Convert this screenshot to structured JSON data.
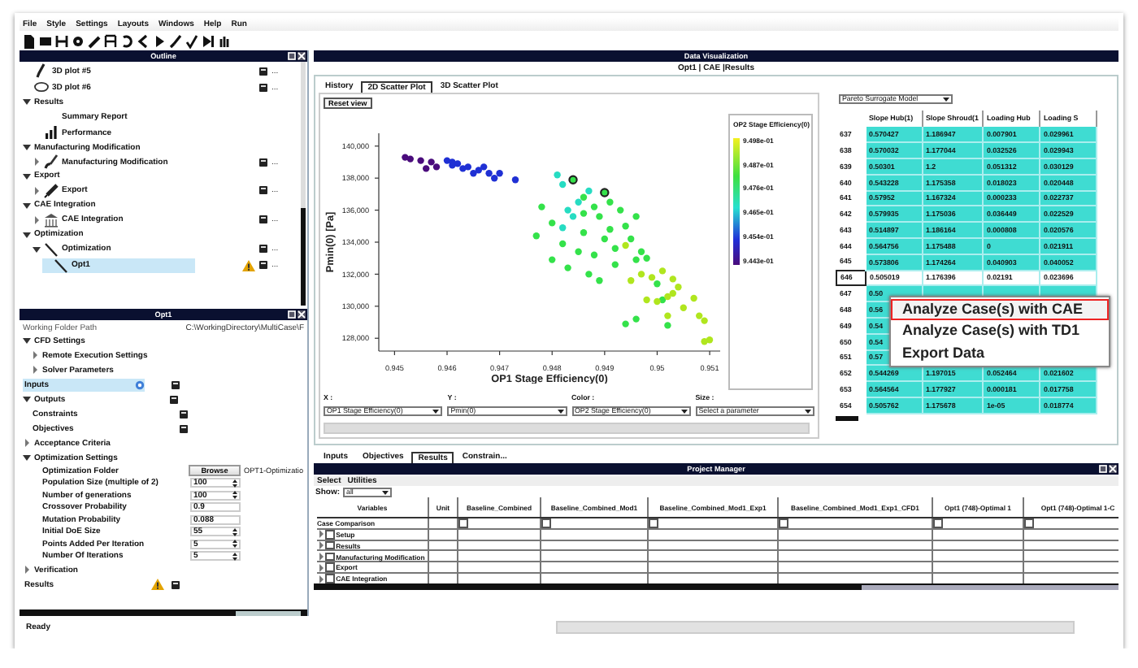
{
  "menu_bar": [
    "File",
    "Style",
    "Settings",
    "Layouts",
    "Windows",
    "Help",
    "Run"
  ],
  "outline": {
    "title": "Outline",
    "items": [
      {
        "kind": "entry",
        "label": "3D plot #5",
        "selected": false,
        "doc": true,
        "action": "..."
      },
      {
        "kind": "entry",
        "label": "3D plot #6",
        "selected": false,
        "doc": true,
        "action": "..."
      },
      {
        "kind": "section",
        "label": "Results",
        "expanded": true,
        "children": [
          {
            "kind": "entry",
            "label": "Summary Report",
            "selected": false
          },
          {
            "kind": "entry",
            "label": "Performance",
            "selected": false
          }
        ]
      },
      {
        "kind": "section",
        "label": "Manufacturing Modification",
        "expanded": true,
        "children": [
          {
            "kind": "entry",
            "label": "Manufacturing Modification",
            "expanded": false,
            "selected": false,
            "doc": true,
            "action": "..."
          }
        ]
      },
      {
        "kind": "section",
        "label": "Export",
        "expanded": true,
        "children": [
          {
            "kind": "entry",
            "label": "Export",
            "expanded": false,
            "selected": false,
            "doc": true,
            "action": "..."
          }
        ]
      },
      {
        "kind": "section",
        "label": "CAE Integration",
        "expanded": true,
        "children": [
          {
            "kind": "entry",
            "label": "CAE Integration",
            "expanded": false,
            "selected": false,
            "doc": true,
            "action": "..."
          }
        ]
      },
      {
        "kind": "section",
        "label": "Optimization",
        "expanded": true,
        "children": [
          {
            "kind": "entry",
            "label": "Optimization",
            "expanded": true,
            "selected": false,
            "doc": true,
            "action": "...",
            "children": [
              {
                "kind": "entry",
                "label": "Opt1",
                "selected": true,
                "warning": true,
                "doc": true,
                "action": "..."
              }
            ]
          }
        ]
      }
    ]
  },
  "properties": {
    "title": "Opt1",
    "path": {
      "label": "Working Folder Path",
      "value": "C:\\WorkingDirectory\\MultiCase\\F"
    },
    "items": [
      {
        "kind": "section",
        "label": "CFD Settings",
        "expanded": true,
        "children": [
          {
            "kind": "section",
            "label": "Remote Execution Settings",
            "expanded": false
          },
          {
            "kind": "section",
            "label": "Solver Parameters",
            "expanded": false
          }
        ]
      },
      {
        "kind": "entry",
        "label": "Inputs",
        "selected": true,
        "info": true,
        "doc": true
      },
      {
        "kind": "section",
        "label": "Outputs",
        "expanded": true,
        "doc": true,
        "children": [
          {
            "kind": "entry",
            "label": "Constraints",
            "selected": false,
            "doc": true
          },
          {
            "kind": "entry",
            "label": "Objectives",
            "selected": false,
            "doc": true
          }
        ]
      },
      {
        "kind": "section",
        "label": "Acceptance Criteria",
        "expanded": false
      },
      {
        "kind": "section",
        "label": "Optimization Settings",
        "expanded": true,
        "children": [
          {
            "kind": "browse",
            "label": "Optimization Folder",
            "button": "Browse",
            "value": "OPT1-Optimizatio"
          },
          {
            "kind": "spin",
            "label": "Population Size (multiple of 2)",
            "value": "100"
          },
          {
            "kind": "spin",
            "label": "Number of generations",
            "value": "100"
          },
          {
            "kind": "text",
            "label": "Crossover Probability",
            "value": "0.9"
          },
          {
            "kind": "text",
            "label": "Mutation Probability",
            "value": "0.088"
          },
          {
            "kind": "spin",
            "label": "Initial DoE Size",
            "value": "55"
          },
          {
            "kind": "spin",
            "label": "Points Added Per Iteration",
            "value": "5"
          },
          {
            "kind": "spin",
            "label": "Number Of Iterations",
            "value": "5"
          }
        ]
      },
      {
        "kind": "section",
        "label": "Verification",
        "expanded": false
      },
      {
        "kind": "entry",
        "label": "Results",
        "selected": false,
        "warning": true,
        "doc": true
      }
    ]
  },
  "visualization": {
    "title": "Data Visualization",
    "subtitle": "Opt1 | CAE |Results",
    "tabs": [
      {
        "label": "History",
        "selected": false
      },
      {
        "label": "2D Scatter Plot",
        "selected": true
      },
      {
        "label": "3D Scatter Plot",
        "selected": false
      }
    ],
    "reset_button": "Reset view",
    "chart_data": {
      "type": "scatter",
      "xlabel": "OP1 Stage Efficiency(0)",
      "ylabel": "Pmin(0) [Pa]",
      "xlim": [
        0.9447,
        0.9512
      ],
      "ylim": [
        127200,
        140800
      ],
      "xticks": [
        {
          "value": 0.945,
          "label": "0.945"
        },
        {
          "value": 0.946,
          "label": "0.946"
        },
        {
          "value": 0.947,
          "label": "0.947"
        },
        {
          "value": 0.948,
          "label": "0.948"
        },
        {
          "value": 0.949,
          "label": "0.949"
        },
        {
          "value": 0.95,
          "label": "0.95"
        },
        {
          "value": 0.951,
          "label": "0.951"
        }
      ],
      "yticks": [
        {
          "value": 128000,
          "label": "128,000"
        },
        {
          "value": 130000,
          "label": "130,000"
        },
        {
          "value": 132000,
          "label": "132,000"
        },
        {
          "value": 134000,
          "label": "134,000"
        },
        {
          "value": 136000,
          "label": "136,000"
        },
        {
          "value": 138000,
          "label": "138,000"
        },
        {
          "value": 140000,
          "label": "140,000"
        }
      ],
      "series": [
        {
          "color": "#4a0c7c",
          "x": [
            0.9452,
            0.9453,
            0.9455,
            0.9456,
            0.9457,
            0.9458
          ],
          "values": [
            139300,
            139200,
            139100,
            138600,
            139000,
            138700
          ]
        },
        {
          "color": "#1f30d4",
          "x": [
            0.946,
            0.9461,
            0.9462,
            0.9463,
            0.9464,
            0.9465,
            0.9466,
            0.9467,
            0.9468,
            0.947,
            0.9473,
            0.9461,
            0.9469
          ],
          "values": [
            139100,
            138800,
            138900,
            138600,
            138700,
            138300,
            138500,
            138700,
            138300,
            138300,
            137900,
            139000,
            138000
          ]
        },
        {
          "color": "#26dcc2",
          "x": [
            0.9481,
            0.9482,
            0.9483,
            0.9485,
            0.9487,
            0.9482,
            0.9484
          ],
          "values": [
            138200,
            137600,
            136000,
            136500,
            137200,
            134900,
            135600
          ]
        },
        {
          "color": "#34e24a",
          "x": [
            0.9478,
            0.9477,
            0.948,
            0.9482,
            0.9486,
            0.9488,
            0.9489,
            0.9491,
            0.9493,
            0.9494,
            0.9486,
            0.9488,
            0.949,
            0.9492,
            0.9495,
            0.9497,
            0.9483,
            0.9485,
            0.9487,
            0.9489,
            0.9492,
            0.9494,
            0.9496,
            0.9498,
            0.95,
            0.9501,
            0.9502,
            0.9496,
            0.9486,
            0.9491,
            0.948,
            0.9496
          ],
          "values": [
            136200,
            134400,
            135200,
            133900,
            136800,
            136200,
            135600,
            134800,
            136000,
            135000,
            134600,
            133200,
            134200,
            133600,
            134200,
            133400,
            132400,
            133400,
            132000,
            131600,
            132600,
            128900,
            132900,
            133000,
            131400,
            130400,
            128800,
            129200,
            135800,
            136500,
            132900,
            135600
          ]
        },
        {
          "color": "#b0e61e",
          "x": [
            0.9495,
            0.9497,
            0.9499,
            0.9501,
            0.9503,
            0.9504,
            0.9505,
            0.9507,
            0.9502,
            0.9508,
            0.9494,
            0.9498,
            0.95,
            0.9502,
            0.9509,
            0.951,
            0.9509,
            0.9503
          ],
          "values": [
            131600,
            132000,
            131800,
            132200,
            130800,
            131200,
            129900,
            130500,
            129400,
            129400,
            133800,
            130400,
            130300,
            130600,
            129100,
            127900,
            127800,
            131700
          ]
        },
        {
          "color": "#34e24a",
          "marker": "circle",
          "x": [
            0.9484,
            0.949
          ],
          "values": [
            137900,
            137100
          ]
        }
      ]
    },
    "color_scale": {
      "title": "OP2 Stage Efficiency(0)",
      "labels": [
        "9.498e-01",
        "9.487e-01",
        "9.476e-01",
        "9.465e-01",
        "9.454e-01",
        "9.443e-01"
      ]
    },
    "selectors": [
      {
        "label": "X :",
        "value": "OP1 Stage Efficiency(0)"
      },
      {
        "label": "Y :",
        "value": "Pmin(0)"
      },
      {
        "label": "Color :",
        "value": "OP2 Stage Efficiency(0)"
      },
      {
        "label": "Size :",
        "value": "Select a parameter"
      }
    ]
  },
  "surrogate": {
    "model": "Pareto Surrogate Model",
    "columns": [
      "Slope Hub(1)",
      "Slope Shroud(1",
      "Loading Hub",
      "Loading S"
    ],
    "rows": [
      {
        "id": "637",
        "selected": true,
        "cells": [
          "0.570427",
          "1.186947",
          "0.007901",
          "0.029961"
        ]
      },
      {
        "id": "638",
        "selected": true,
        "cells": [
          "0.570032",
          "1.177044",
          "0.032526",
          "0.029943"
        ]
      },
      {
        "id": "639",
        "selected": true,
        "cells": [
          "0.50301",
          "1.2",
          "0.051312",
          "0.030129"
        ]
      },
      {
        "id": "640",
        "selected": true,
        "cells": [
          "0.543228",
          "1.175358",
          "0.018023",
          "0.020448"
        ]
      },
      {
        "id": "641",
        "selected": true,
        "cells": [
          "0.57952",
          "1.167324",
          "0.000233",
          "0.022737"
        ]
      },
      {
        "id": "642",
        "selected": true,
        "cells": [
          "0.579935",
          "1.175036",
          "0.036449",
          "0.022529"
        ]
      },
      {
        "id": "643",
        "selected": true,
        "cells": [
          "0.514897",
          "1.186164",
          "0.000808",
          "0.020576"
        ]
      },
      {
        "id": "644",
        "selected": true,
        "cells": [
          "0.564756",
          "1.175488",
          "0",
          "0.021911"
        ]
      },
      {
        "id": "645",
        "selected": true,
        "cells": [
          "0.573806",
          "1.174264",
          "0.040903",
          "0.040052"
        ]
      },
      {
        "id": "646",
        "selected": false,
        "cells": [
          "0.505019",
          "1.176396",
          "0.02191",
          "0.023696"
        ]
      },
      {
        "id": "647",
        "selected": true,
        "cells": [
          "0.50"
        ]
      },
      {
        "id": "648",
        "selected": true,
        "cells": [
          "0.56"
        ]
      },
      {
        "id": "649",
        "selected": true,
        "cells": [
          "0.54"
        ]
      },
      {
        "id": "650",
        "selected": true,
        "cells": [
          "0.54"
        ]
      },
      {
        "id": "651",
        "selected": true,
        "cells": [
          "0.57"
        ]
      },
      {
        "id": "652",
        "selected": true,
        "cells": [
          "0.544269",
          "1.197015",
          "0.052464",
          "0.021602"
        ]
      },
      {
        "id": "653",
        "selected": true,
        "cells": [
          "0.564564",
          "1.177927",
          "0.000181",
          "0.017758"
        ]
      },
      {
        "id": "654",
        "selected": true,
        "cells": [
          "0.505762",
          "1.175678",
          "1e-05",
          "0.018774"
        ]
      }
    ]
  },
  "context_menu": [
    {
      "label": "Analyze Case(s) with CAE",
      "selected": true
    },
    {
      "label": "Analyze Case(s) with TD1",
      "selected": false
    },
    {
      "label": "Export Data",
      "selected": false
    }
  ],
  "bottom_tabs": [
    {
      "label": "Inputs",
      "selected": false
    },
    {
      "label": "Objectives",
      "selected": false
    },
    {
      "label": "Results",
      "selected": true
    },
    {
      "label": "Constrain...",
      "selected": false
    }
  ],
  "project_manager": {
    "title": "Project Manager",
    "menu": [
      "Select",
      "Utilities"
    ],
    "show": {
      "label": "Show:",
      "value": "all"
    },
    "columns": [
      "Variables",
      "Unit",
      "Baseline_Combined",
      "Baseline_Combined_Mod1",
      "Baseline_Combined_Mod1_Exp1",
      "Baseline_Combined_Mod1_Exp1_CFD1",
      "Opt1 (748)-Optimal 1",
      "Opt1 (748)-Optimal 1-C"
    ],
    "rows": [
      {
        "kind": "header",
        "label": "Case Comparison",
        "checks": [
          false,
          false,
          false,
          false,
          false,
          false
        ]
      },
      {
        "kind": "group",
        "label": "Setup",
        "expanded": false,
        "checked": false
      },
      {
        "kind": "group",
        "label": "Results",
        "expanded": false,
        "checked": false
      },
      {
        "kind": "group",
        "label": "Manufacturing Modification",
        "expanded": false,
        "checked": false
      },
      {
        "kind": "group",
        "label": "Export",
        "expanded": false,
        "checked": false
      },
      {
        "kind": "group",
        "label": "CAE Integration",
        "expanded": false,
        "checked": false
      }
    ]
  },
  "status_bar": "Ready"
}
